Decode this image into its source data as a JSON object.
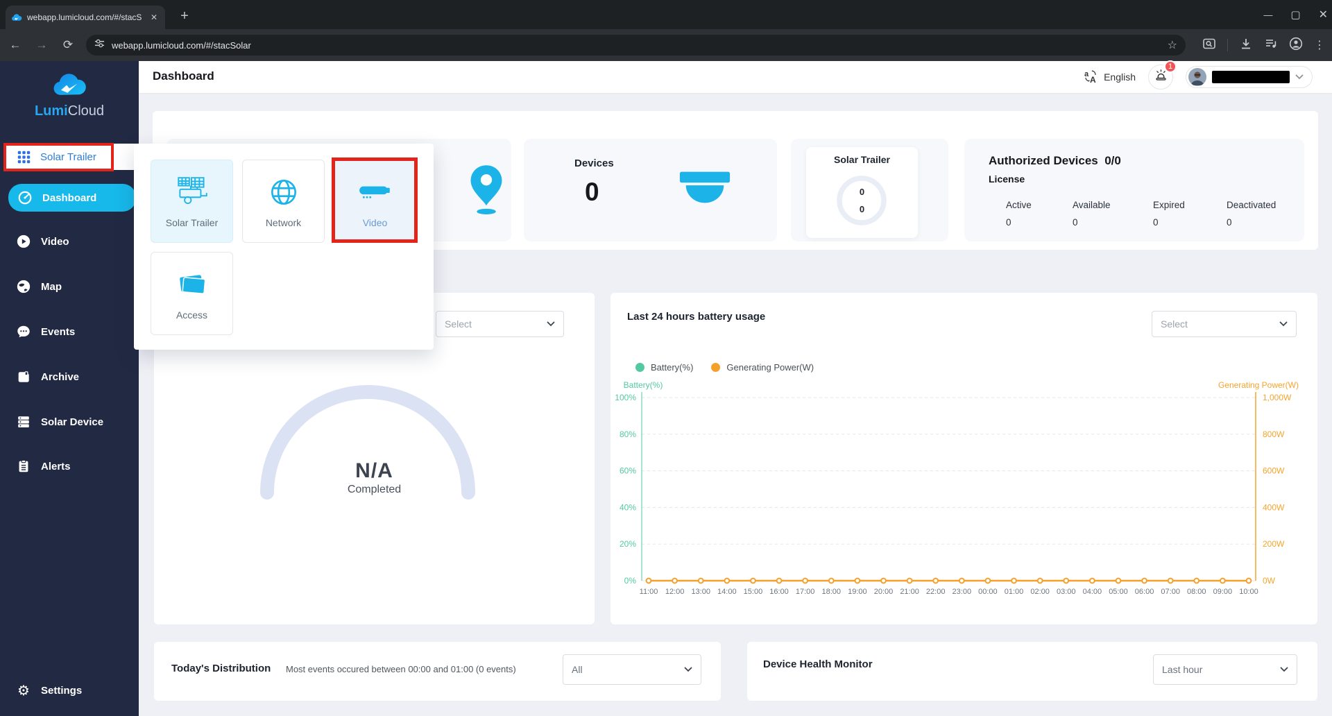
{
  "browser": {
    "tab_title": "webapp.lumicloud.com/#/stacS",
    "url": "webapp.lumicloud.com/#/stacSolar"
  },
  "sidebar": {
    "logo_part1": "Lumi",
    "logo_part2": "Cloud",
    "selector_label": "Solar Trailer",
    "items": [
      {
        "label": "Dashboard",
        "icon": "gauge-icon",
        "active": true
      },
      {
        "label": "Video",
        "icon": "play-icon",
        "active": false
      },
      {
        "label": "Map",
        "icon": "map-icon",
        "active": false
      },
      {
        "label": "Events",
        "icon": "chat-icon",
        "active": false
      },
      {
        "label": "Archive",
        "icon": "archive-icon",
        "active": false
      },
      {
        "label": "Solar Device",
        "icon": "server-icon",
        "active": false
      },
      {
        "label": "Alerts",
        "icon": "clipboard-icon",
        "active": false
      }
    ],
    "settings_label": "Settings"
  },
  "popup": {
    "cards": [
      {
        "label": "Solar Trailer",
        "icon": "solar-trailer-icon",
        "state": "selected"
      },
      {
        "label": "Network",
        "icon": "network-icon",
        "state": "normal"
      },
      {
        "label": "Video",
        "icon": "video-camera-icon",
        "state": "highlighted"
      },
      {
        "label": "Access",
        "icon": "access-cards-icon",
        "state": "normal"
      }
    ]
  },
  "header": {
    "title": "Dashboard",
    "language": "English",
    "notification_count": "1"
  },
  "stats": {
    "devices": {
      "label": "Devices",
      "value": "0"
    },
    "solar_trailer": {
      "title": "Solar Trailer",
      "value_top": "0",
      "value_bottom": "0"
    },
    "authorized": {
      "title": "Authorized Devices",
      "ratio": "0/0",
      "subtitle": "License",
      "columns": [
        {
          "label": "Active",
          "value": "0"
        },
        {
          "label": "Available",
          "value": "0"
        },
        {
          "label": "Expired",
          "value": "0"
        },
        {
          "label": "Deactivated",
          "value": "0"
        }
      ]
    }
  },
  "gauge_card": {
    "select_placeholder": "Select",
    "value": "N/A",
    "label": "Completed",
    "arc_color": "#dbe2f3"
  },
  "battery_card": {
    "title": "Last 24 hours battery usage",
    "select_placeholder": "Select"
  },
  "chart_data": {
    "type": "line",
    "title": "Last 24 hours battery usage",
    "x": [
      "11:00",
      "12:00",
      "13:00",
      "14:00",
      "15:00",
      "16:00",
      "17:00",
      "18:00",
      "19:00",
      "20:00",
      "21:00",
      "22:00",
      "23:00",
      "00:00",
      "01:00",
      "02:00",
      "03:00",
      "04:00",
      "05:00",
      "06:00",
      "07:00",
      "08:00",
      "09:00",
      "10:00"
    ],
    "series": [
      {
        "name": "Battery(%)",
        "color": "#52c9a2",
        "axis": "left",
        "values": []
      },
      {
        "name": "Generating Power(W)",
        "color": "#f5a02b",
        "axis": "right",
        "values": [
          0,
          0,
          0,
          0,
          0,
          0,
          0,
          0,
          0,
          0,
          0,
          0,
          0,
          0,
          0,
          0,
          0,
          0,
          0,
          0,
          0,
          0,
          0,
          0
        ]
      }
    ],
    "y_left": {
      "label": "Battery(%)",
      "min": 0,
      "max": 100,
      "ticks": [
        "100%",
        "80%",
        "60%",
        "40%",
        "20%",
        "0%"
      ],
      "color": "#52c9a2"
    },
    "y_right": {
      "label": "Generating Power(W)",
      "min": 0,
      "max": 1000,
      "ticks": [
        "1,000W",
        "800W",
        "600W",
        "400W",
        "200W",
        "0W"
      ],
      "color": "#f5a42c"
    },
    "legend_position": "top-left",
    "grid": "dashed-horizontal"
  },
  "distribution_card": {
    "title": "Today's Distribution",
    "subtitle": "Most events occured between 00:00 and 01:00 (0 events)",
    "select_value": "All"
  },
  "health_card": {
    "title": "Device Health Monitor",
    "select_value": "Last hour"
  }
}
